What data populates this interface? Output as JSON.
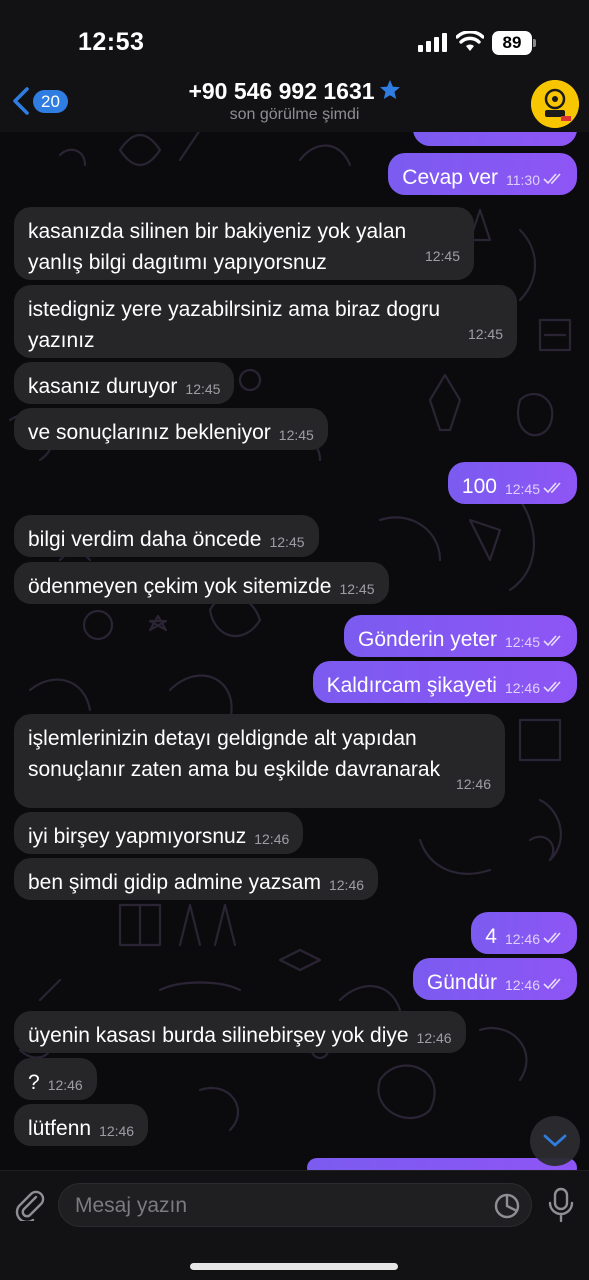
{
  "status_bar": {
    "time": "12:53",
    "battery": "89"
  },
  "header": {
    "back_badge": "20",
    "contact": "+90 546 992 1631",
    "status": "son görülme şimdi"
  },
  "messages": [
    {
      "dir": "out",
      "text": "Cevap ver",
      "time": "11:30"
    },
    {
      "dir": "in",
      "text": "kasanızda silinen bir bakiyeniz yok yalan yanlış bilgi dagıtımı yapıyorsnuz",
      "time": "12:45"
    },
    {
      "dir": "in",
      "text": "istedigniz yere yazabilrsiniz ama biraz dogru yazınız",
      "time": "12:45"
    },
    {
      "dir": "in",
      "text": "kasanız duruyor",
      "time": "12:45"
    },
    {
      "dir": "in",
      "text": "ve sonuçlarınız bekleniyor",
      "time": "12:45"
    },
    {
      "dir": "out",
      "text": "100",
      "time": "12:45"
    },
    {
      "dir": "in",
      "text": "bilgi verdim daha öncede",
      "time": "12:45"
    },
    {
      "dir": "in",
      "text": "ödenmeyen çekim yok sitemizde",
      "time": "12:45"
    },
    {
      "dir": "out",
      "text": "Gönderin yeter",
      "time": "12:45"
    },
    {
      "dir": "out",
      "text": "Kaldırcam şikayeti",
      "time": "12:46"
    },
    {
      "dir": "in",
      "text": "işlemlerinizin detayı geldignde alt yapıdan sonuçlanır zaten ama bu eşkilde davranarak",
      "time": "12:46"
    },
    {
      "dir": "in",
      "text": "iyi birşey yapmıyorsnuz",
      "time": "12:46"
    },
    {
      "dir": "in",
      "text": "ben şimdi gidip admine yazsam",
      "time": "12:46"
    },
    {
      "dir": "out",
      "text": "4",
      "time": "12:46"
    },
    {
      "dir": "out",
      "text": "Gündür",
      "time": "12:46"
    },
    {
      "dir": "in",
      "text": "üyenin kasası burda silinebirşey yok diye",
      "time": "12:46"
    },
    {
      "dir": "in",
      "text": "?",
      "time": "12:46"
    },
    {
      "dir": "in",
      "text": "lütfenn",
      "time": "12:46"
    }
  ],
  "input": {
    "placeholder": "Mesaj yazın"
  },
  "colors": {
    "outgoing": "#8a57f3",
    "incoming": "#262629",
    "accent": "#2f7de1"
  },
  "icons": [
    "signal-icon",
    "wifi-icon",
    "battery-icon",
    "back-chevron-icon",
    "star-icon",
    "attach-icon",
    "sticker-icon",
    "mic-icon",
    "chevron-down-icon",
    "double-check-icon"
  ]
}
